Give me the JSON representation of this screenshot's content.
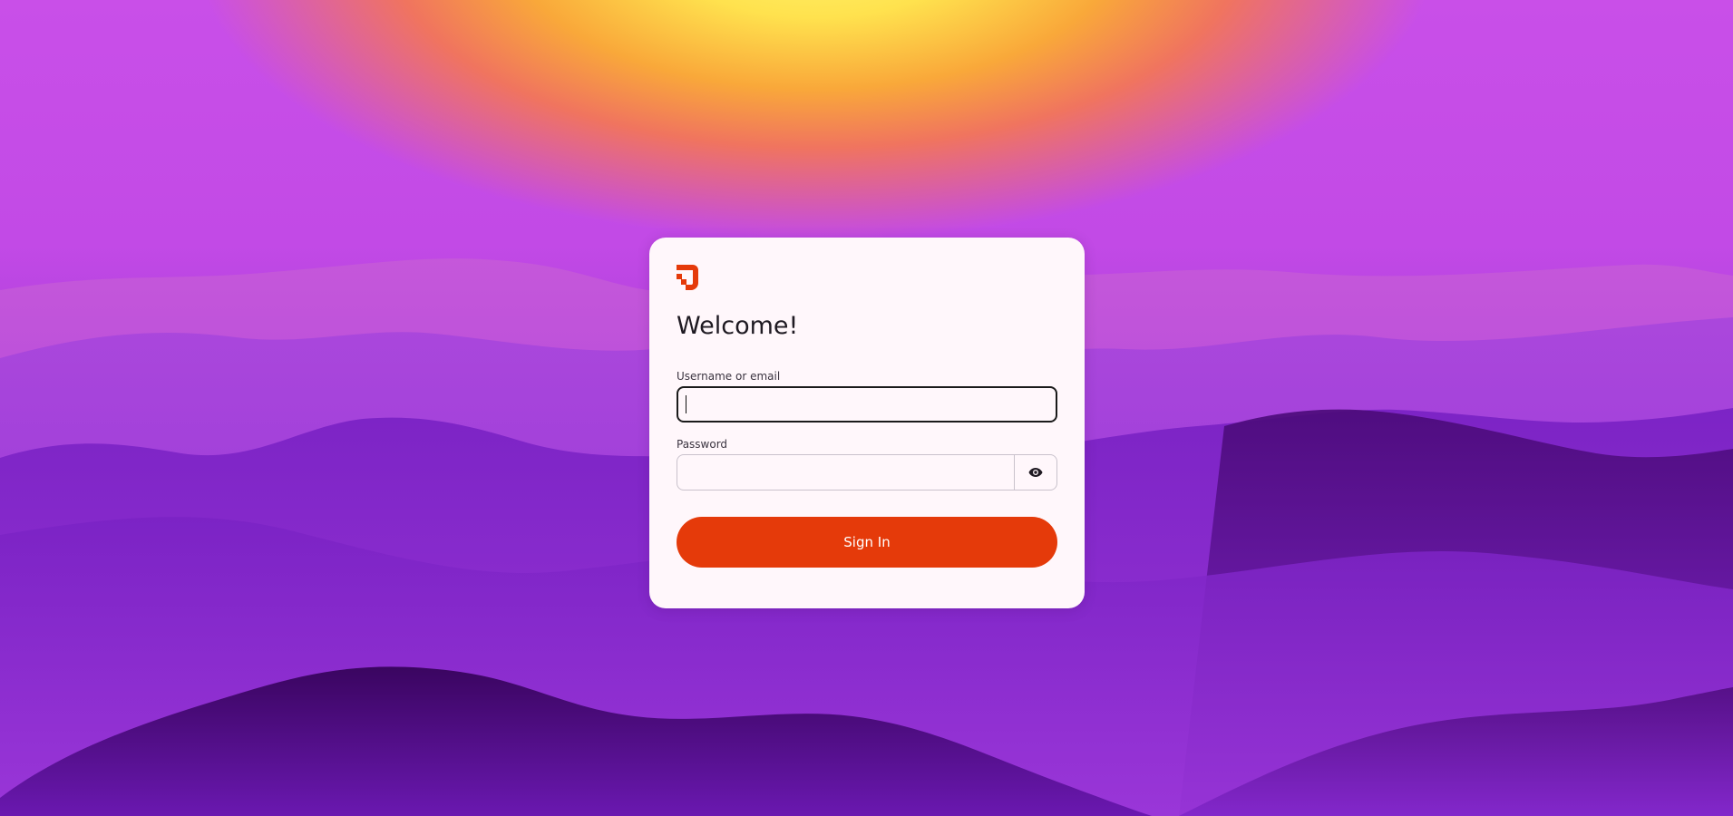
{
  "login": {
    "title": "Welcome!",
    "username_label": "Username or email",
    "username_value": "",
    "password_label": "Password",
    "password_value": "",
    "show_password_icon": "eye-icon",
    "sign_in_label": "Sign In"
  },
  "brand": {
    "logo_icon": "brand-logo-icon",
    "accent_color": "#e53a0a"
  }
}
